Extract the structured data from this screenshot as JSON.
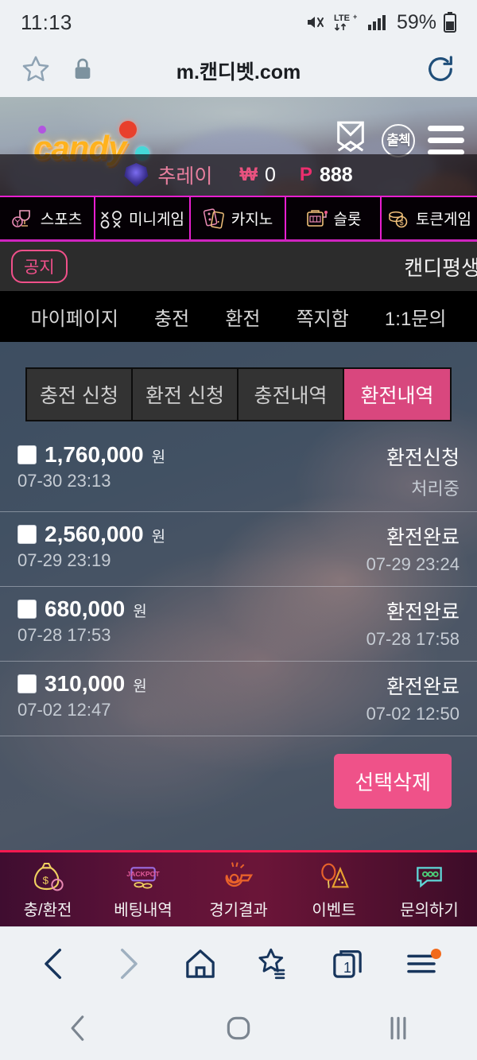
{
  "status_bar": {
    "time": "11:13",
    "battery_percent": "59%",
    "network": "LTE+",
    "icons": [
      "mute-icon",
      "lte-icon",
      "signal-icon",
      "battery-icon"
    ]
  },
  "browser": {
    "url": "m.캔디벳.com",
    "icons": [
      "star-icon",
      "lock-icon",
      "reload-icon"
    ],
    "bottom": {
      "back": "back-icon",
      "forward": "forward-icon",
      "home": "home-icon",
      "bookmarks": "bookmarks-star-icon",
      "tabs_count": "1",
      "menu": "menu-icon"
    }
  },
  "site_header": {
    "logo_text": "candy",
    "icons": [
      "message-icon",
      "attendance-check-icon",
      "hamburger-menu-icon"
    ],
    "attendance_label": "출첵"
  },
  "user_bar": {
    "rank_icon": "rank-emblem-icon",
    "username": "추레이",
    "money_symbol": "₩",
    "money_value": "0",
    "point_symbol": "P",
    "point_value": "888"
  },
  "category_menu": [
    {
      "label": "스포츠",
      "icon": "trophy-ball-icon"
    },
    {
      "label": "미니게임",
      "icon": "tictactoe-icon"
    },
    {
      "label": "카지노",
      "icon": "playing-cards-icon"
    },
    {
      "label": "슬롯",
      "icon": "slot-machine-icon"
    },
    {
      "label": "토큰게임",
      "icon": "coins-icon"
    }
  ],
  "notice": {
    "badge": "공지",
    "text": "캔디평생"
  },
  "sub_nav": [
    "마이페이지",
    "충전",
    "환전",
    "쪽지함",
    "1:1문의"
  ],
  "tabs": [
    {
      "label": "충전 신청",
      "active": false
    },
    {
      "label": "환전 신청",
      "active": false
    },
    {
      "label": "충전내역",
      "active": false
    },
    {
      "label": "환전내역",
      "active": true
    }
  ],
  "history_rows": [
    {
      "amount": "1,760,000",
      "unit": "원",
      "requested_at": "07-30 23:13",
      "status": "환전신청",
      "sub_status": "처리중"
    },
    {
      "amount": "2,560,000",
      "unit": "원",
      "requested_at": "07-29 23:19",
      "status": "환전완료",
      "sub_status": "07-29 23:24"
    },
    {
      "amount": "680,000",
      "unit": "원",
      "requested_at": "07-28 17:53",
      "status": "환전완료",
      "sub_status": "07-28 17:58"
    },
    {
      "amount": "310,000",
      "unit": "원",
      "requested_at": "07-02 12:47",
      "status": "환전완료",
      "sub_status": "07-02 12:50"
    }
  ],
  "delete_button": "선택삭제",
  "site_bottom_nav": [
    {
      "label": "충/환전",
      "icon": "money-bag-icon"
    },
    {
      "label": "베팅내역",
      "icon": "jackpot-icon"
    },
    {
      "label": "경기결과",
      "icon": "whistle-icon"
    },
    {
      "label": "이벤트",
      "icon": "balloons-party-icon"
    },
    {
      "label": "문의하기",
      "icon": "chat-bubble-icon"
    }
  ],
  "android_nav": [
    "back-nav-icon",
    "home-nav-icon",
    "recents-nav-icon"
  ],
  "colors": {
    "accent_pink": "#ef5289",
    "active_tab": "#d9477e",
    "menu_border": "#e81fd0",
    "notice_badge": "#f0508a",
    "username": "#e87f9e",
    "point": "#ec2f6e",
    "bottom_nav_border": "#f5194f",
    "content_bg": "#4e5c6d",
    "browser_chrome": "#eef1f4"
  }
}
